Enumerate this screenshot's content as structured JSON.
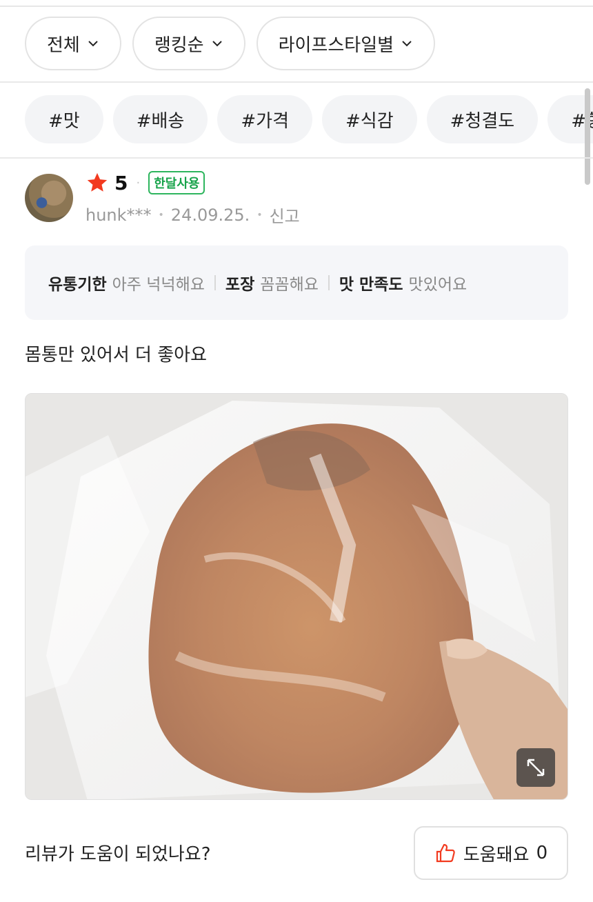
{
  "filters": [
    {
      "label": "전체"
    },
    {
      "label": "랭킹순"
    },
    {
      "label": "라이프스타일별"
    }
  ],
  "tags": [
    "#맛",
    "#배송",
    "#가격",
    "#식감",
    "#청결도",
    "#향기",
    "#"
  ],
  "review": {
    "rating": "5",
    "badge": "한달사용",
    "author": "hunk***",
    "date": "24.09.25.",
    "report": "신고",
    "attributes": [
      {
        "key": "유통기한",
        "value": "아주 넉넉해요"
      },
      {
        "key": "포장",
        "value": "꼼꼼해요"
      },
      {
        "key": "맛 만족도",
        "value": "맛있어요"
      }
    ],
    "text": "몸통만 있어서 더 좋아요",
    "photo_icon": "expand-icon"
  },
  "helpful": {
    "question": "리뷰가 도움이 되었나요?",
    "button_label": "도움돼요",
    "count": "0"
  },
  "colors": {
    "star": "#f23a1f",
    "badge": "#17a34a",
    "thumb": "#f23a1f"
  }
}
